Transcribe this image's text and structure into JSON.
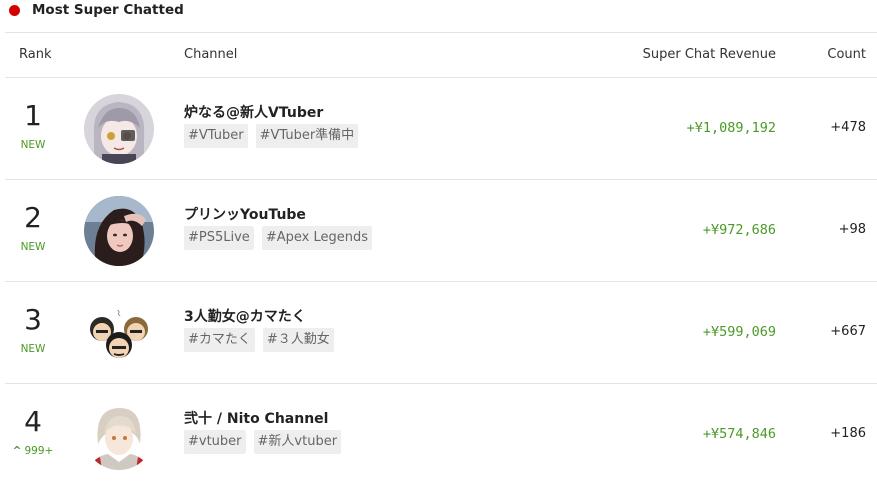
{
  "header": {
    "title": "Most Super Chatted"
  },
  "columns": {
    "rank": "Rank",
    "channel": "Channel",
    "revenue": "Super Chat Revenue",
    "count": "Count"
  },
  "rows": [
    {
      "rank": "1",
      "change": "NEW",
      "name": "炉なる@新人VTuber",
      "tags": [
        "#VTuber",
        "#VTuber準備中"
      ],
      "revenue": "+¥1,089,192",
      "count": "+478"
    },
    {
      "rank": "2",
      "change": "NEW",
      "name": "プリンッYouTube",
      "tags": [
        "#PS5Live",
        "#Apex Legends"
      ],
      "revenue": "+¥972,686",
      "count": "+98"
    },
    {
      "rank": "3",
      "change": "NEW",
      "name": "3人勤女@カマたく",
      "tags": [
        "#カマたく",
        "#３人勤女"
      ],
      "revenue": "+¥599,069",
      "count": "+667"
    },
    {
      "rank": "4",
      "change": "999+",
      "change_icon": "up-arrow-icon",
      "name": "弐十 / Nito Channel",
      "tags": [
        "#vtuber",
        "#新人vtuber"
      ],
      "revenue": "+¥574,846",
      "count": "+186"
    }
  ],
  "colors": {
    "live_dot": "#d40000",
    "positive": "#4a9a26",
    "tag_bg": "#eeeeee"
  }
}
